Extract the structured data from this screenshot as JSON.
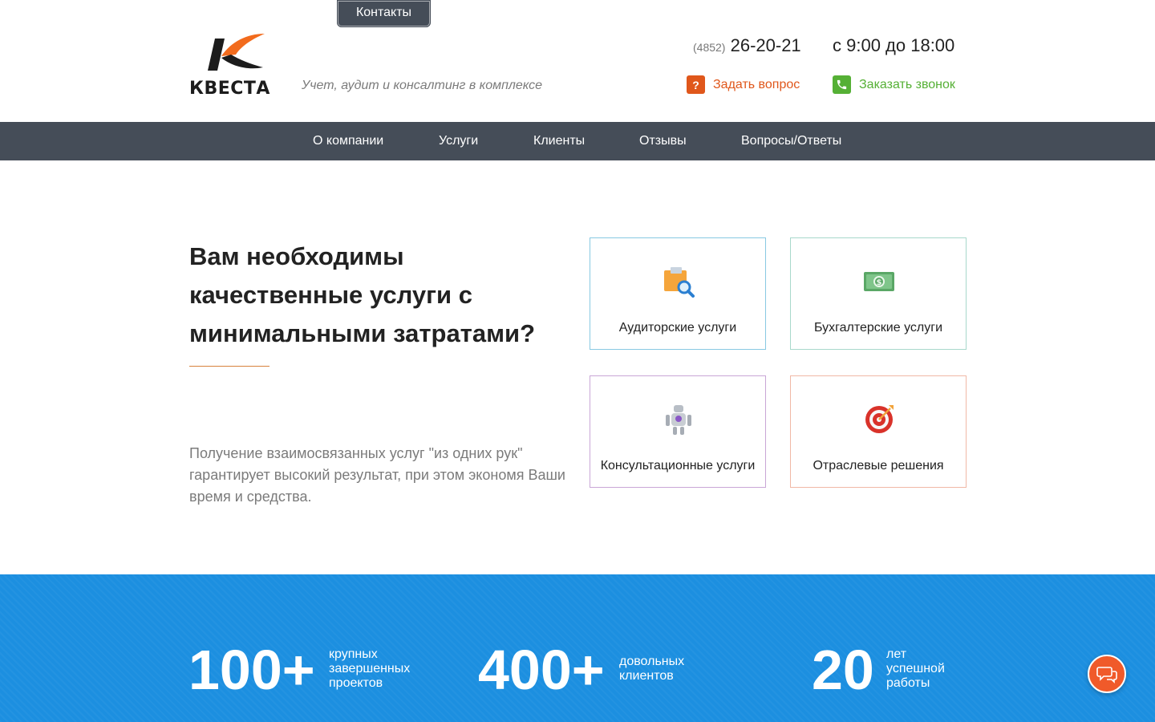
{
  "top": {
    "contacts_label": "Контакты"
  },
  "header": {
    "logo_text": "КВЕСТА",
    "tagline": "Учет, аудит и консалтинг в комплексе",
    "phone_code": "(4852)",
    "phone_number": "26-20-21",
    "hours": "с 9:00 до 18:00",
    "ask_label": "Задать вопрос",
    "ask_icon_glyph": "?",
    "call_label": "Заказать звонок"
  },
  "nav": {
    "items": [
      {
        "label": "О компании"
      },
      {
        "label": "Услуги"
      },
      {
        "label": "Клиенты"
      },
      {
        "label": "Отзывы"
      },
      {
        "label": "Вопросы/Ответы"
      }
    ]
  },
  "hero": {
    "title": "Вам необходимы качественные услуги с минимальными затратами?",
    "description": "Получение взаимосвязанных услуг \"из одних рук\" гарантирует высокий результат, при этом экономя Ваши время и средства."
  },
  "services": [
    {
      "label": "Аудиторские услуги",
      "icon": "audit-folder-magnifier-icon"
    },
    {
      "label": "Бухгалтерские услуги",
      "icon": "money-bill-icon"
    },
    {
      "label": "Консультационные услуги",
      "icon": "robot-icon"
    },
    {
      "label": "Отраслевые решения",
      "icon": "target-icon"
    }
  ],
  "stats": [
    {
      "number": "100+",
      "label_lines": [
        "крупных",
        "завершенных",
        "проектов"
      ]
    },
    {
      "number": "400+",
      "label_lines": [
        "довольных",
        "клиентов"
      ]
    },
    {
      "number": "20",
      "label_lines": [
        "лет",
        "успешной",
        "работы"
      ]
    }
  ],
  "colors": {
    "nav_bg": "#454d58",
    "accent_orange": "#e0571b",
    "accent_green": "#55b035",
    "stats_bg": "#1c8fe0",
    "chat_button": "#f05a2a"
  }
}
